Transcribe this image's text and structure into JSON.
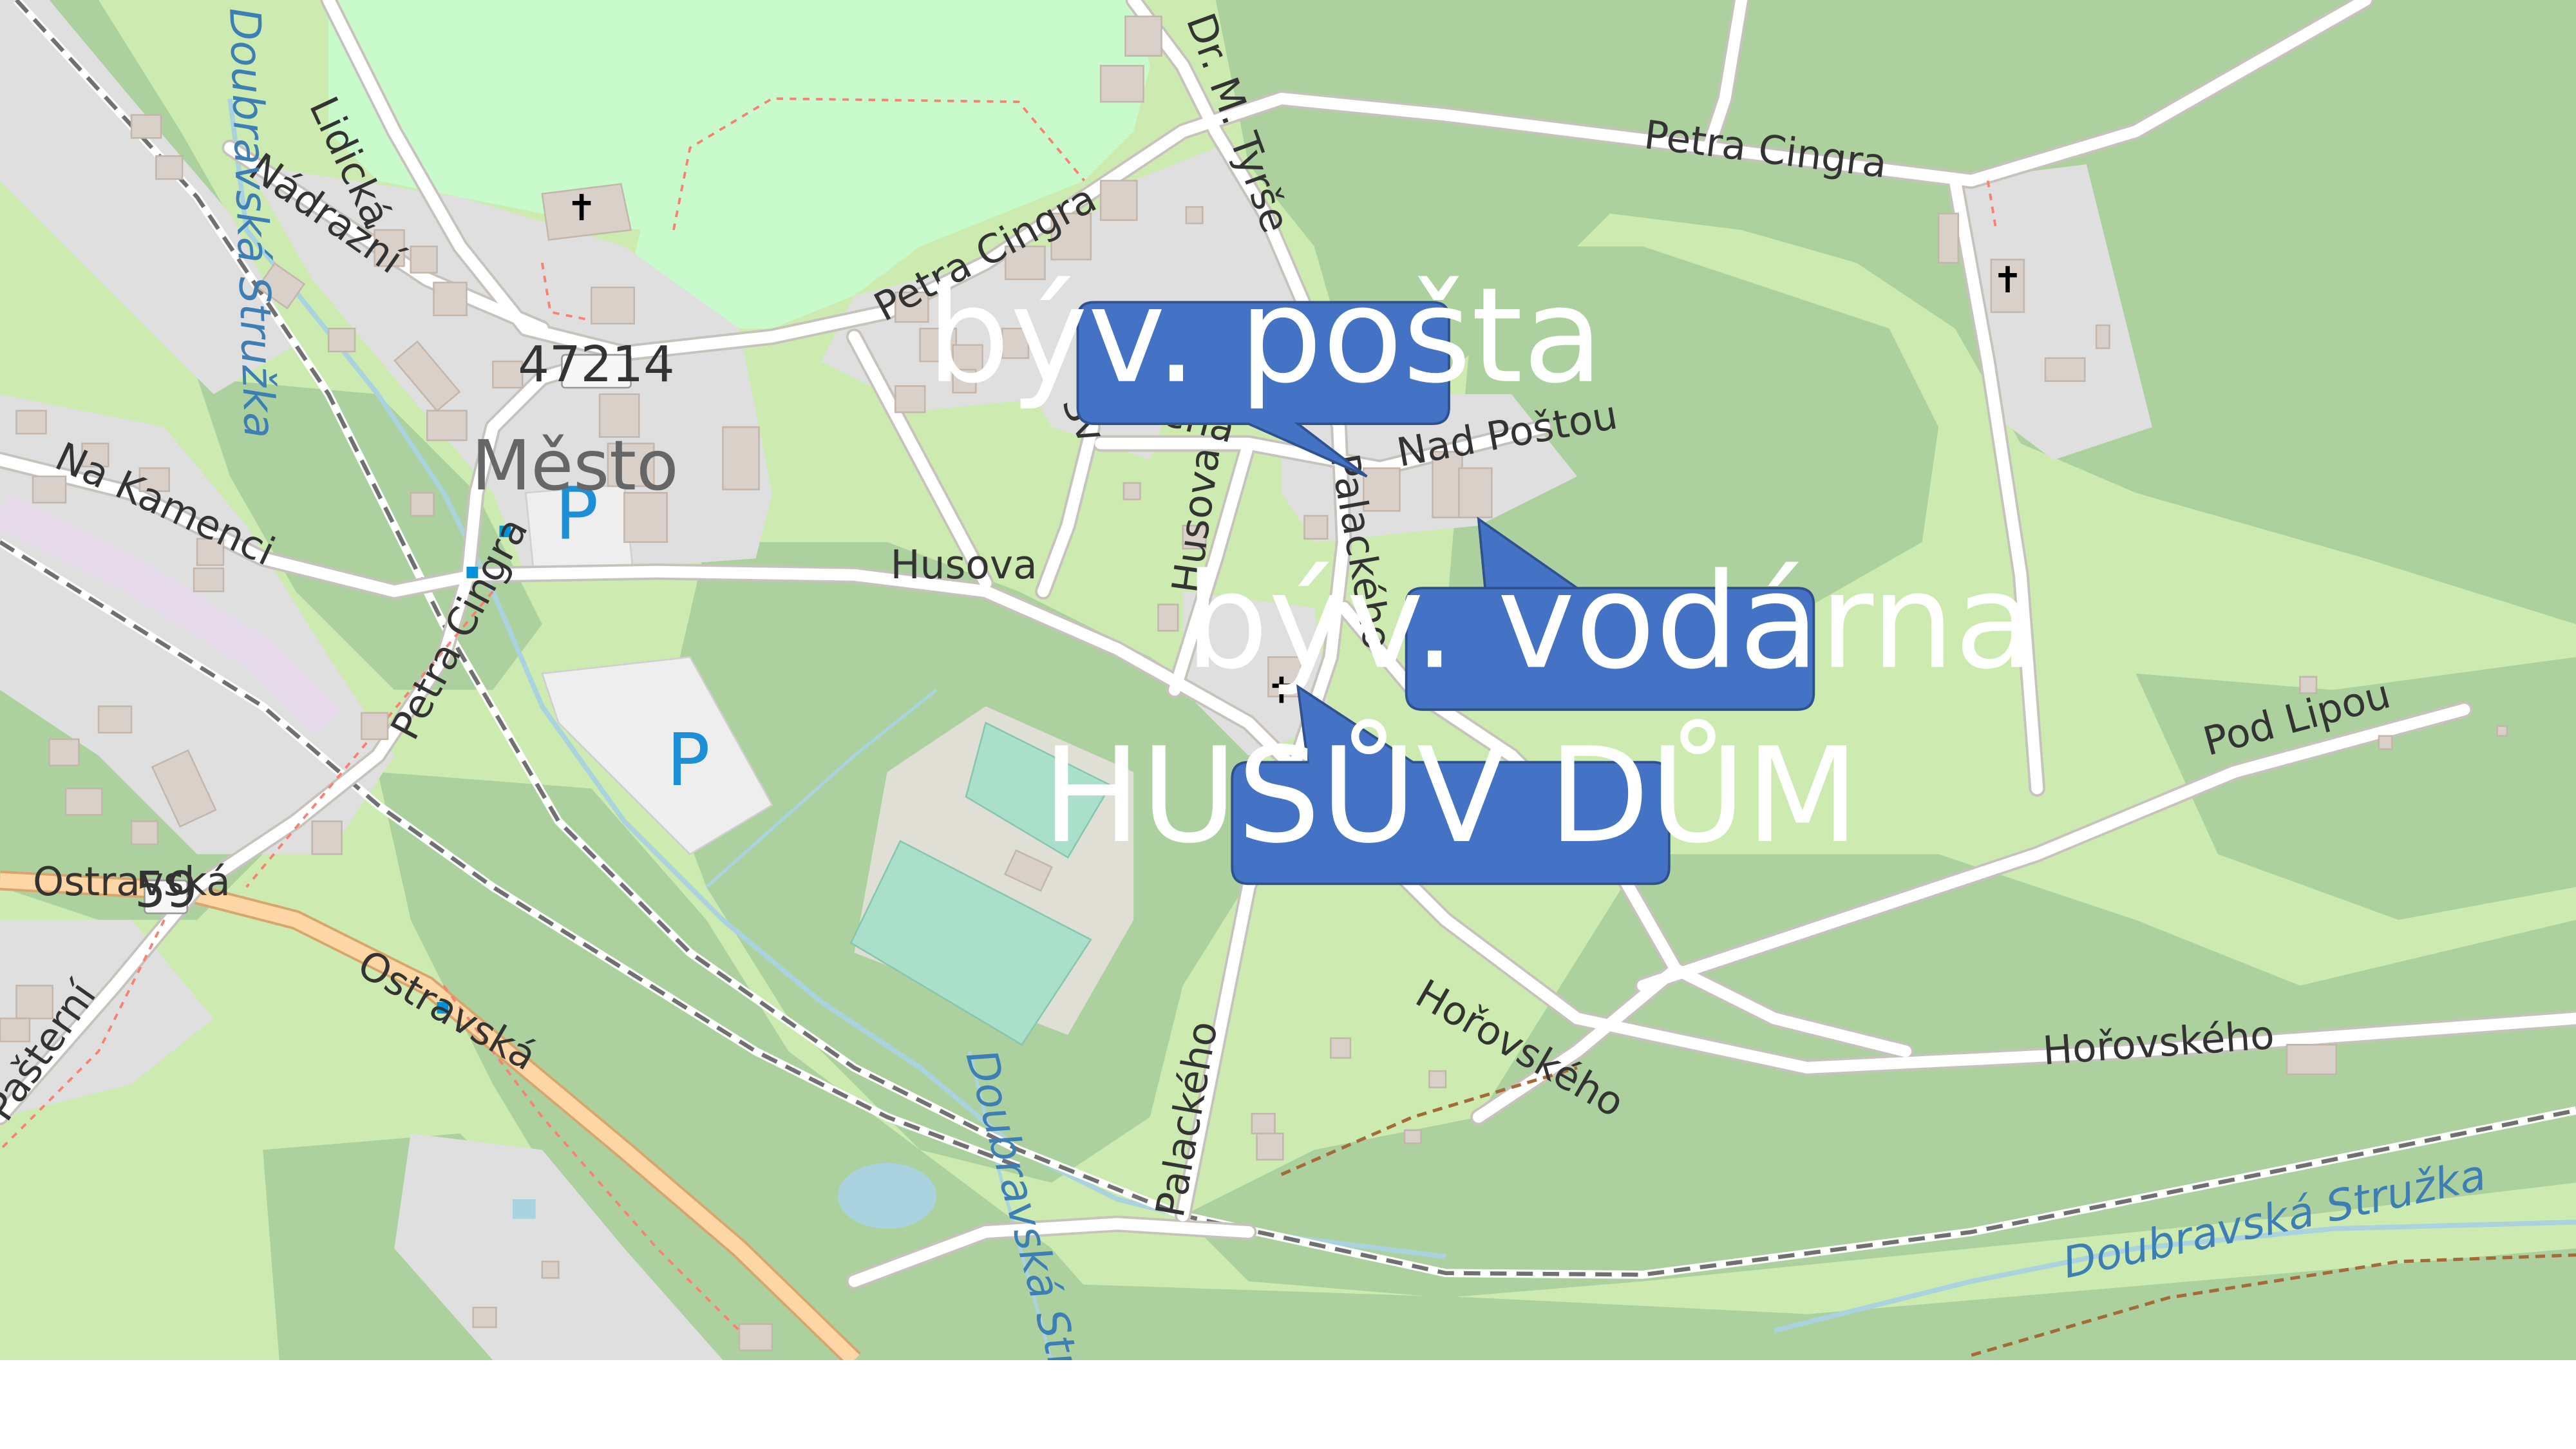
{
  "callouts": [
    {
      "id": "posta",
      "label": "býv. pošta"
    },
    {
      "id": "vodarna",
      "label": "býv. vodárna"
    },
    {
      "id": "husuv",
      "label": "HUSŮV DŮM"
    }
  ],
  "streets": {
    "petra_cingra_top": "Petra Cingra",
    "petra_cingra_mid": "Petra Cingra",
    "petra_cingra_low": "Petra Cingra",
    "tyrse": "Dr. M. Tyrše",
    "nadrazni": "Nádražní",
    "lidicka": "Lidická",
    "na_kamenci": "Na Kamenci",
    "husova_h": "Husova",
    "husova_v": "Husova",
    "palackeho_top": "Palackého",
    "palackeho_bottom": "Palackého",
    "nad_postou": "Nad Poštou",
    "pod_lipou": "Pod Lipou",
    "horovskeho_1": "Hořovského",
    "horovskeho_2": "Hořovského",
    "ostravska_1": "Ostravská",
    "ostravska_2": "Ostravská",
    "pasterni": "Pašterní",
    "svermova": "Šv",
    "svermova2": "ená"
  },
  "places": {
    "mesto": "Město"
  },
  "rivers": {
    "doubravska_top": "Doubravská Stružka",
    "doubravska_mid": "Doubravská Stružka",
    "doubravska_right": "Doubravská Stružka"
  },
  "road_refs": {
    "r47214": "47214",
    "r59": "59"
  },
  "parking": {
    "p1": "P",
    "p2": "P"
  },
  "icons": {
    "church": "cross-icon",
    "bus_stop": "bus-stop-icon"
  },
  "colors": {
    "forest": "#add19e",
    "grass": "#cdebb0",
    "park": "#c8facc",
    "residential": "#e0dfdf",
    "building": "#d9d0c9",
    "road": "#ffffff",
    "trunk": "#fcd6a4",
    "water": "#aad3df",
    "pitch": "#aae0cb",
    "parking": "#eeeeee",
    "callout": "#4472c4",
    "railway": "#707070"
  }
}
